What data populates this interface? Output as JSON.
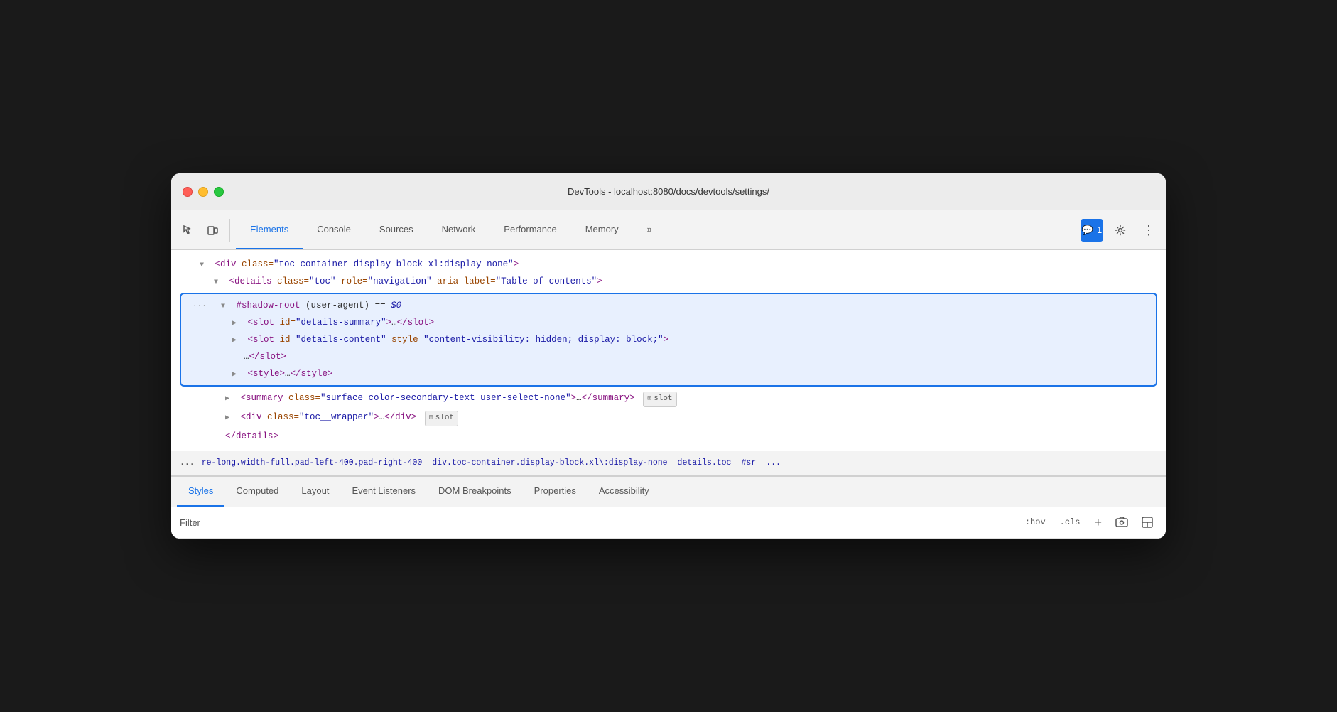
{
  "window": {
    "title": "DevTools - localhost:8080/docs/devtools/settings/"
  },
  "toolbar": {
    "tabs": [
      {
        "id": "elements",
        "label": "Elements",
        "active": true
      },
      {
        "id": "console",
        "label": "Console",
        "active": false
      },
      {
        "id": "sources",
        "label": "Sources",
        "active": false
      },
      {
        "id": "network",
        "label": "Network",
        "active": false
      },
      {
        "id": "performance",
        "label": "Performance",
        "active": false
      },
      {
        "id": "memory",
        "label": "Memory",
        "active": false
      }
    ],
    "more_button": "»",
    "chat_badge": "1",
    "settings_label": "⚙",
    "more_menu_label": "⋮"
  },
  "dom_tree": {
    "lines": [
      {
        "id": "line1",
        "indent": 0,
        "triangle": "down",
        "content": "<div class=\"toc-container display-block xl:display-none\">"
      },
      {
        "id": "line2",
        "indent": 1,
        "triangle": "down",
        "content": "<details class=\"toc\" role=\"navigation\" aria-label=\"Table of contents\">"
      }
    ],
    "shadow_root_block": {
      "header": "#shadow-root (user-agent) == $0",
      "lines": [
        {
          "id": "sr1",
          "indent": 1,
          "triangle": "right",
          "content": "<slot id=\"details-summary\">…</slot>"
        },
        {
          "id": "sr2",
          "indent": 1,
          "triangle": "right",
          "content": "<slot id=\"details-content\" style=\"content-visibility: hidden; display: block;\">"
        },
        {
          "id": "sr2b",
          "indent": 2,
          "triangle": null,
          "content": "…</slot>"
        },
        {
          "id": "sr3",
          "indent": 1,
          "triangle": "right",
          "content": "<style>…</style>"
        }
      ]
    },
    "after_lines": [
      {
        "id": "al1",
        "indent": 1,
        "triangle": "right",
        "has_slot": true,
        "slot_label": "slot",
        "content": "<summary class=\"surface color-secondary-text user-select-none\">…</summary>"
      },
      {
        "id": "al2",
        "indent": 1,
        "triangle": "right",
        "has_slot": true,
        "slot_label": "slot",
        "content": "<div class=\"toc__wrapper\">…</div>"
      },
      {
        "id": "al3",
        "indent": 1,
        "triangle": null,
        "content": "</details>"
      }
    ]
  },
  "breadcrumb": {
    "ellipsis": "...",
    "items": [
      {
        "id": "bc1",
        "label": "re-long.width-full.pad-left-400.pad-right-400",
        "active": false
      },
      {
        "id": "bc2",
        "label": "div.toc-container.display-block.xl\\:display-none",
        "active": false
      },
      {
        "id": "bc3",
        "label": "details.toc",
        "active": false
      },
      {
        "id": "bc4",
        "label": "#sr",
        "active": false
      },
      {
        "id": "bc5",
        "label": "...",
        "active": false
      }
    ]
  },
  "bottom_panel": {
    "tabs": [
      {
        "id": "styles",
        "label": "Styles",
        "active": true
      },
      {
        "id": "computed",
        "label": "Computed",
        "active": false
      },
      {
        "id": "layout",
        "label": "Layout",
        "active": false
      },
      {
        "id": "event-listeners",
        "label": "Event Listeners",
        "active": false
      },
      {
        "id": "dom-breakpoints",
        "label": "DOM Breakpoints",
        "active": false
      },
      {
        "id": "properties",
        "label": "Properties",
        "active": false
      },
      {
        "id": "accessibility",
        "label": "Accessibility",
        "active": false
      }
    ]
  },
  "styles_bar": {
    "filter_placeholder": "Filter",
    "hov_label": ":hov",
    "cls_label": ".cls",
    "plus_label": "+",
    "icons": {
      "screenshot": "📷",
      "arrow": "←"
    }
  }
}
